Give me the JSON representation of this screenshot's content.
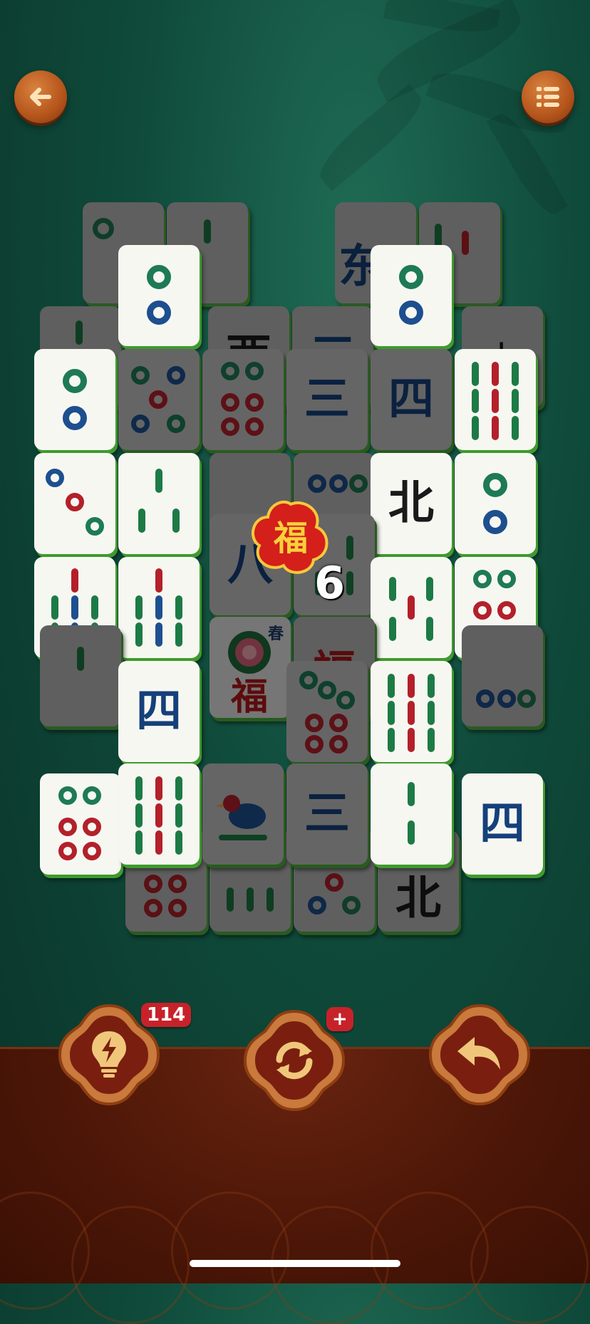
{
  "top_bar": {
    "back_icon": "arrow-left-icon",
    "menu_icon": "list-icon"
  },
  "board": {
    "combo_value": "6",
    "combo_icon": "fu-character-flower",
    "season_label": "春"
  },
  "actions": {
    "hint": {
      "icon": "lightbulb-bolt-icon",
      "badge": "114"
    },
    "shuffle": {
      "icon": "refresh-arrows-icon",
      "badge": "+"
    },
    "undo": {
      "icon": "undo-arrow-icon"
    }
  },
  "tiles": {
    "three": "三",
    "four": "四",
    "eight": "八",
    "north": "北",
    "west": "西",
    "east": "东"
  },
  "colors": {
    "felt": "#0f4a3a",
    "tile_face": "#f7f7f2",
    "tile_edge": "#3f9a2d",
    "wood": "#b4541b",
    "badge": "#c7222a"
  }
}
